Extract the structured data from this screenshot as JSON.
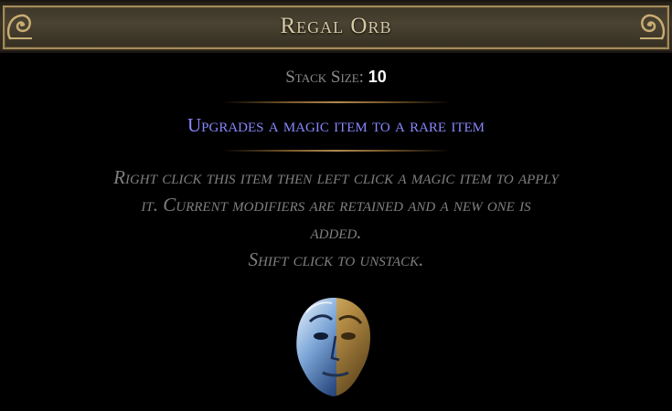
{
  "item": {
    "name": "Regal Orb",
    "stack_label": "Stack Size:",
    "stack_value": "10",
    "description": "Upgrades a magic item to a rare item",
    "flavor_lines": [
      "Right click this item then left click a magic item to apply",
      "it. Current modifiers are retained and a new one is",
      "added.",
      "Shift click to unstack."
    ],
    "icon": "regal-orb-icon"
  },
  "colors": {
    "title": "#d7c9a4",
    "label": "#8c8c8c",
    "value": "#ffffff",
    "magic_description": "#8888ff",
    "flavor": "#7f7f7f",
    "frame_gold": "#a38b5d"
  }
}
